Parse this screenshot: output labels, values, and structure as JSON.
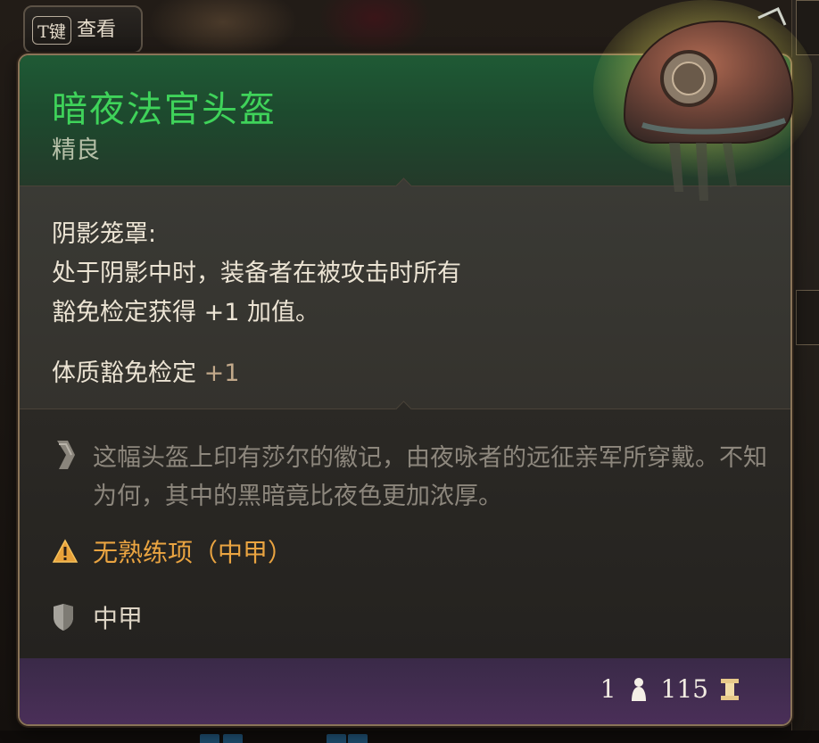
{
  "hint": {
    "key": "T键",
    "label": "查看"
  },
  "item": {
    "name": "暗夜法官头盔",
    "rarity": "精良",
    "title_color": "#3fd35a"
  },
  "passive": {
    "name": "阴影笼罩:",
    "description_line1": "处于阴影中时，装备者在被攻击时所有",
    "description_line2": "豁免检定获得 +1 加值。"
  },
  "stat": {
    "label": "体质豁免检定",
    "value": "+1"
  },
  "flavor": "这幅头盔上印有莎尔的徽记，由夜咏者的远征亲军所穿戴。不知为何，其中的黑暗竟比夜色更加浓厚。",
  "proficiency_warning": "无熟练项（中甲）",
  "armor_type": "中甲",
  "footer": {
    "weight": "1",
    "price": "115"
  },
  "icons": {
    "flavor": "quill-icon",
    "warning": "warning-icon",
    "armor": "shield-icon",
    "weight": "weight-icon",
    "price": "gold-icon"
  }
}
